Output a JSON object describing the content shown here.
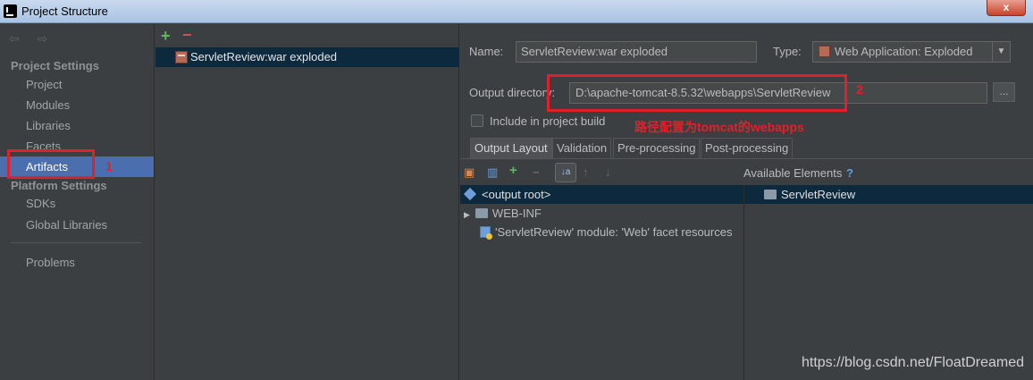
{
  "window": {
    "title": "Project Structure",
    "close_label": "x"
  },
  "nav": {
    "arrows": "⇦ ⇨",
    "project_settings": "Project Settings",
    "items_project": [
      "Project",
      "Modules",
      "Libraries",
      "Facets",
      "Artifacts"
    ],
    "platform_settings": "Platform Settings",
    "items_platform": [
      "SDKs",
      "Global Libraries"
    ],
    "problems": "Problems",
    "selected": "Artifacts"
  },
  "artifacts": {
    "add_label": "+",
    "remove_label": "−",
    "items": [
      "ServletReview:war exploded"
    ]
  },
  "form": {
    "name_label": "Name:",
    "name_value": "ServletReview:war exploded",
    "type_label": "Type:",
    "type_value": "Web Application: Exploded",
    "output_label": "Output directory:",
    "output_value": "D:\\apache-tomcat-8.5.32\\webapps\\ServletReview",
    "browse_label": "...",
    "include_label": "Include in project build"
  },
  "tabs": [
    "Output Layout",
    "Validation",
    "Pre-processing",
    "Post-processing"
  ],
  "layout": {
    "available_label": "Available Elements",
    "help": "?",
    "tree": [
      "<output root>",
      "WEB-INF",
      "'ServletReview' module: 'Web' facet resources"
    ],
    "available": [
      "ServletReview"
    ]
  },
  "annotations": {
    "mark1": "1",
    "mark2": "2",
    "note": "路径配置为tomcat的webapps"
  },
  "watermark": "https://blog.csdn.net/FloatDreamed",
  "colors": {
    "selection": "#4b6eaf",
    "annotation": "#e0202a"
  }
}
